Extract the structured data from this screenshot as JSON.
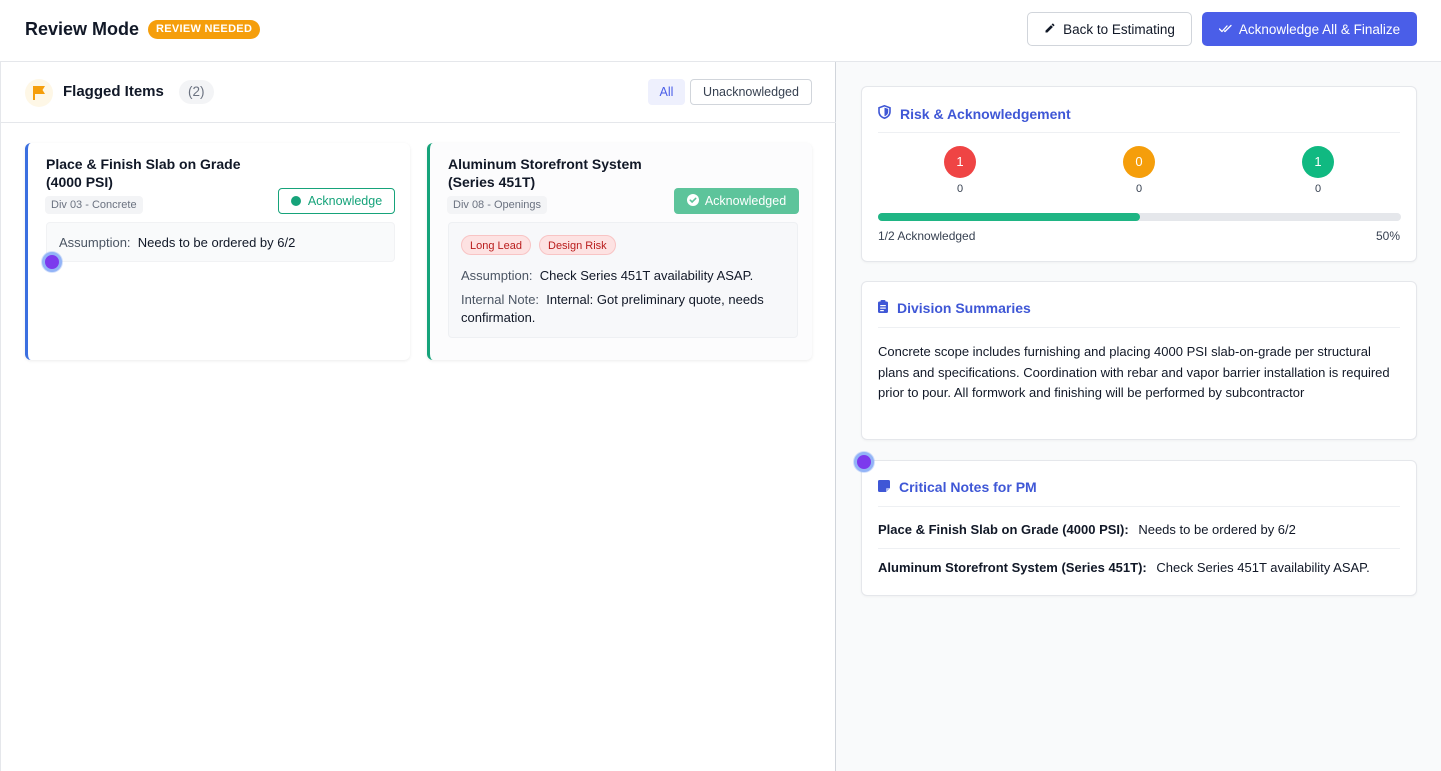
{
  "header": {
    "title": "Review Mode",
    "badge": "REVIEW NEEDED",
    "back_button": "Back to Estimating",
    "finalize_button": "Acknowledge All & Finalize"
  },
  "flagged": {
    "title": "Flagged Items",
    "count": "(2)",
    "filters": {
      "all": "All",
      "unacknowledged": "Unacknowledged"
    },
    "items": [
      {
        "title": "Place & Finish Slab on Grade (4000 PSI)",
        "division": "Div 03 - Concrete",
        "action": "Acknowledge",
        "assumption_label": "Assumption:",
        "assumption": "Needs to be ordered by 6/2"
      },
      {
        "title": "Aluminum Storefront System (Series 451T)",
        "division": "Div 08 - Openings",
        "action": "Acknowledged",
        "tags": [
          "Long Lead",
          "Design Risk"
        ],
        "assumption_label": "Assumption:",
        "assumption": "Check Series 451T availability ASAP.",
        "internal_label": "Internal Note:",
        "internal": "Internal: Got preliminary quote, needs confirmation."
      }
    ]
  },
  "risk": {
    "title": "Risk & Acknowledgement",
    "levels": [
      {
        "value": "1",
        "count": "0",
        "color": "#ef4444"
      },
      {
        "value": "0",
        "count": "0",
        "color": "#f59e0b"
      },
      {
        "value": "1",
        "count": "0",
        "color": "#10b981"
      }
    ],
    "progress_label": "1/2 Acknowledged",
    "progress_percent": "50%",
    "progress_value": 0.5
  },
  "division_summaries": {
    "title": "Division Summaries",
    "text": "Concrete scope includes furnishing and placing 4000 PSI slab-on-grade per structural plans and specifications. Coordination with rebar and vapor barrier installation is required prior to pour. All formwork and finishing will be performed by subcontractor"
  },
  "critical_notes": {
    "title": "Critical Notes for PM",
    "rows": [
      {
        "item": "Place & Finish Slab on Grade (4000 PSI):",
        "note": "Needs to be ordered by 6/2"
      },
      {
        "item": "Aluminum Storefront System (Series 451T):",
        "note": "Check Series 451T availability ASAP."
      }
    ]
  },
  "colors": {
    "primary": "#4a5ee8",
    "warning": "#f59e0b",
    "success": "#16a37a",
    "danger": "#ef4444"
  },
  "icons": [
    "pencil-icon",
    "double-check-icon",
    "flag-icon",
    "check-circle-icon",
    "shield-icon",
    "clipboard-icon",
    "sticky-note-icon"
  ]
}
